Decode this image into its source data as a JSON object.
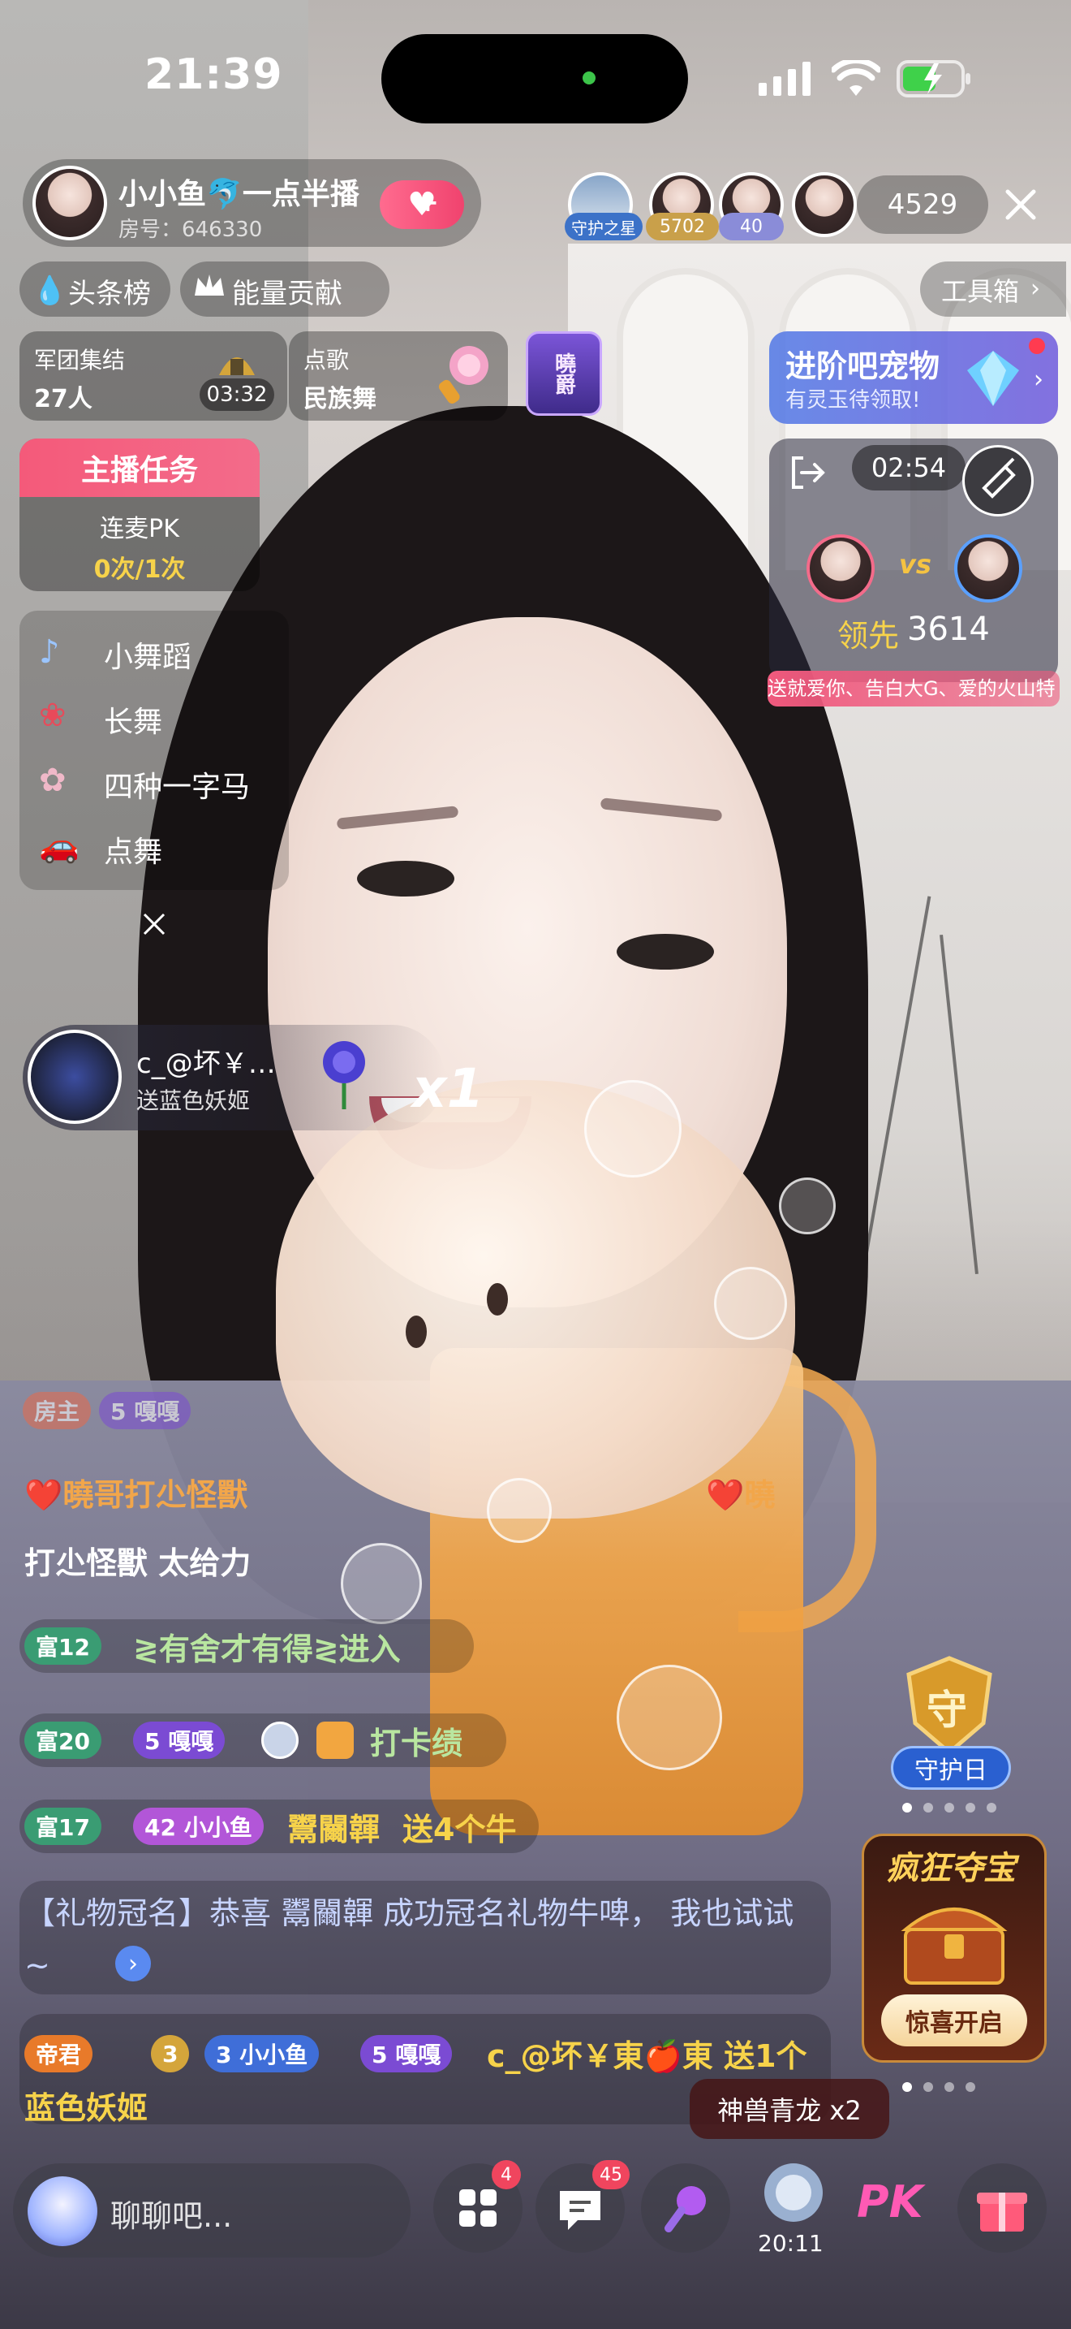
{
  "status_bar": {
    "time": "21:39"
  },
  "host": {
    "name": "小小鱼🐬一点半播",
    "room_id": "房号：646330",
    "follow_label": "+"
  },
  "top_viewers": {
    "badges": [
      "守护之星",
      "5702",
      "40"
    ],
    "count": "4529"
  },
  "nav": {
    "headline_label": "头条榜",
    "energy_label": "能量贡献",
    "toolbox_label": "工具箱"
  },
  "cards": {
    "legion": {
      "title": "军团集结",
      "count": "27人",
      "timer": "03:32"
    },
    "song": {
      "title": "点歌",
      "value": "民族舞"
    },
    "rank_badge": "曉爵"
  },
  "promo": {
    "title": "进阶吧宠物",
    "subtitle": "有灵玉待领取!"
  },
  "task": {
    "header": "主播任务",
    "name": "连麦PK",
    "progress_text": "0次/1次"
  },
  "pk_panel": {
    "timer": "02:54",
    "vs": "vs",
    "lead_label": "领先",
    "lead_value": "3614",
    "marquee": "送就爱你、告白大G、爱的火山特"
  },
  "dance_menu": {
    "items": [
      "小舞蹈",
      "长舞",
      "四种一字马",
      "点舞"
    ]
  },
  "gift_notice": {
    "user": "c_@坏￥…",
    "action": "送蓝色妖姬",
    "multiplier": "x1"
  },
  "chat": {
    "row0": {
      "badges": [
        "房主",
        "5 嘎嘎"
      ]
    },
    "row1": {
      "text": "❤️曉哥打尐怪獸",
      "trail": "❤️曉"
    },
    "row2": {
      "text": "打尐怪獸 太给力"
    },
    "row3": {
      "level": "富12",
      "text": "≷有舍才有得≷进入"
    },
    "row4": {
      "level": "富20",
      "fan": "5 嘎嘎",
      "text": "打卡绩"
    },
    "row5": {
      "level": "富17",
      "fan": "42 小小鱼",
      "user": "鬻䦵韗",
      "text": "送4个牛"
    },
    "row6": {
      "text": "【礼物冠名】恭喜 鬻䦵韗 成功冠名礼物牛啤， 我也试试~"
    },
    "row7": {
      "badge1": "帝君",
      "badge2": "3",
      "fan1": "3 小小鱼",
      "fan2": "5 嘎嘎",
      "text": "c_@坏￥東🍎東 送1个蓝色妖姬"
    }
  },
  "guard_day": {
    "icon": "守",
    "label": "守护日"
  },
  "treasure": {
    "title": "疯狂夺宝",
    "button": "惊喜开启"
  },
  "gift_toast": "神兽青龙 x2",
  "bottom_bar": {
    "chat_placeholder": "聊聊吧...",
    "apps_badge": "4",
    "msg_badge": "45",
    "timer": "20:11",
    "pk_label": "PK"
  },
  "colors": {
    "accent_pink": "#f05a7e",
    "gold": "#f5c342",
    "purple": "#6b4bd3"
  }
}
